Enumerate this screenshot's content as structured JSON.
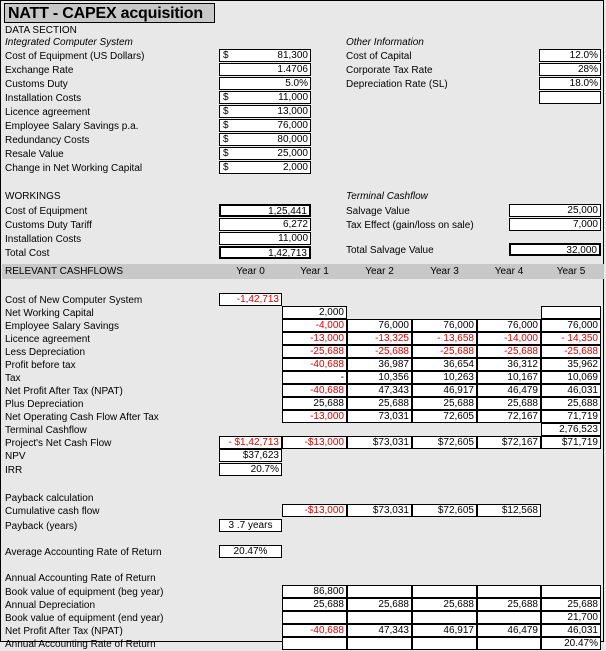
{
  "title": "NATT - CAPEX acquisition",
  "sections": {
    "data_section": "DATA SECTION",
    "workings": "WORKINGS",
    "relevant_cashflows": "RELEVANT CASHFLOWS"
  },
  "data_section": {
    "subtitle": "Integrated Computer System",
    "rows": [
      {
        "label": "Cost of Equipment (US Dollars)",
        "symbol": "$",
        "value": "81,300"
      },
      {
        "label": "Exchange Rate",
        "symbol": "",
        "value": "1.4706"
      },
      {
        "label": "Customs Duty",
        "symbol": "",
        "value": "5.0%"
      },
      {
        "label": "Installation Costs",
        "symbol": "$",
        "value": "11,000"
      },
      {
        "label": "Licence agreement",
        "symbol": "$",
        "value": "13,000"
      },
      {
        "label": "Employee Salary Savings p.a.",
        "symbol": "$",
        "value": "76,000"
      },
      {
        "label": "Redundancy Costs",
        "symbol": "$",
        "value": "80,000"
      },
      {
        "label": "Resale Value",
        "symbol": "$",
        "value": "25,000"
      },
      {
        "label": "Change in Net Working Capital",
        "symbol": "$",
        "value": "2,000"
      }
    ]
  },
  "other_information": {
    "subtitle": "Other Information",
    "rows": [
      {
        "label": "Cost of Capital",
        "value": "12.0%"
      },
      {
        "label": "Corporate Tax Rate",
        "value": "28%"
      },
      {
        "label": "Depreciation Rate (SL)",
        "value": "18.0%"
      }
    ]
  },
  "workings": {
    "rows": [
      {
        "label": "Cost of Equipment",
        "value": "1,25,441"
      },
      {
        "label": "Customs Duty Tariff",
        "value": "6,272"
      },
      {
        "label": "Installation Costs",
        "value": "11,000"
      },
      {
        "label": "Total Cost",
        "value": "1,42,713"
      }
    ]
  },
  "terminal_cashflow": {
    "subtitle": "Terminal Cashflow",
    "rows": [
      {
        "label": "Salvage Value",
        "value": "25,000"
      },
      {
        "label": "Tax Effect (gain/loss on sale)",
        "value": "7,000"
      }
    ],
    "total_label": "Total Salvage Value",
    "total_value": "32,000"
  },
  "cashflow_table": {
    "year_headers": [
      "Year 0",
      "Year 1",
      "Year 2",
      "Year 3",
      "Year 4",
      "Year 5"
    ],
    "rows": [
      {
        "label": "Cost of New Computer System",
        "cells": [
          "-1,42,713",
          "",
          "",
          "",
          "",
          ""
        ],
        "neg": [
          true,
          false,
          false,
          false,
          false,
          false
        ],
        "show": [
          true,
          false,
          false,
          false,
          false,
          false
        ],
        "thick": true
      },
      {
        "label": "Net Working Capital",
        "cells": [
          "",
          "2,000",
          "",
          "",
          "",
          ""
        ],
        "neg": [
          false,
          false,
          false,
          false,
          false,
          false
        ],
        "show": [
          false,
          true,
          false,
          false,
          false,
          true
        ]
      },
      {
        "label": "Employee Salary Savings",
        "cells": [
          "",
          "-4,000",
          "76,000",
          "76,000",
          "76,000",
          "76,000"
        ],
        "neg": [
          false,
          true,
          false,
          false,
          false,
          false
        ],
        "show": [
          false,
          true,
          true,
          true,
          true,
          true
        ]
      },
      {
        "label": "Licence agreement",
        "cells": [
          "",
          "-13,000",
          "-13,325",
          "- 13,658",
          "-14,000",
          "- 14,350"
        ],
        "neg": [
          false,
          true,
          true,
          true,
          true,
          true
        ],
        "show": [
          false,
          true,
          true,
          true,
          true,
          true
        ]
      },
      {
        "label": "Less Depreciation",
        "cells": [
          "",
          "-25,688",
          "-25,688",
          "-25,688",
          "-25,688",
          "-25,688"
        ],
        "neg": [
          false,
          true,
          true,
          true,
          true,
          true
        ],
        "show": [
          false,
          true,
          true,
          true,
          true,
          true
        ]
      },
      {
        "label": "Profit before tax",
        "cells": [
          "",
          "-40,688",
          "36,987",
          "36,654",
          "36,312",
          "35,962"
        ],
        "neg": [
          false,
          true,
          false,
          false,
          false,
          false
        ],
        "show": [
          false,
          true,
          true,
          true,
          true,
          true
        ]
      },
      {
        "label": "Tax",
        "cells": [
          "",
          "-",
          "10,356",
          "10,263",
          "10,167",
          "10,069"
        ],
        "neg": [
          false,
          false,
          false,
          false,
          false,
          false
        ],
        "show": [
          false,
          true,
          true,
          true,
          true,
          true
        ]
      },
      {
        "label": "Net Profit After Tax (NPAT)",
        "cells": [
          "",
          "-40,688",
          "47,343",
          "46,917",
          "46,479",
          "46,031"
        ],
        "neg": [
          false,
          true,
          false,
          false,
          false,
          false
        ],
        "show": [
          false,
          true,
          true,
          true,
          true,
          true
        ]
      },
      {
        "label": "Plus Depreciation",
        "cells": [
          "",
          "25,688",
          "25,688",
          "25,688",
          "25,688",
          "25,688"
        ],
        "neg": [
          false,
          false,
          false,
          false,
          false,
          false
        ],
        "show": [
          false,
          true,
          true,
          true,
          true,
          true
        ]
      },
      {
        "label": "Net Operating Cash Flow After Tax",
        "cells": [
          "",
          "-13,000",
          "73,031",
          "72,605",
          "72,167",
          "71,719"
        ],
        "neg": [
          false,
          true,
          false,
          false,
          false,
          false
        ],
        "show": [
          false,
          true,
          true,
          true,
          true,
          true
        ]
      },
      {
        "label": "Terminal Cashflow",
        "cells": [
          "",
          "",
          "",
          "",
          "",
          "2,76,523"
        ],
        "neg": [
          false,
          false,
          false,
          false,
          false,
          false
        ],
        "show": [
          false,
          false,
          false,
          false,
          false,
          true
        ]
      },
      {
        "label": "Project's Net Cash Flow",
        "cells": [
          "- $1,42,713",
          "-$13,000",
          "$73,031",
          "$72,605",
          "$72,167",
          "$71,719"
        ],
        "neg": [
          true,
          true,
          false,
          false,
          false,
          false
        ],
        "show": [
          true,
          true,
          true,
          true,
          true,
          true
        ],
        "thick": true
      }
    ]
  },
  "npv": {
    "label": "NPV",
    "value": "$37,623"
  },
  "irr": {
    "label": "IRR",
    "value": "20.7%"
  },
  "payback": {
    "heading": "Payback calculation",
    "cumulative_label": "Cumulative cash flow",
    "cumulative_cells": [
      "",
      "-$13,000",
      "$73,031",
      "$72,605",
      "$12,568",
      ""
    ],
    "cumulative_neg": [
      false,
      true,
      false,
      false,
      false,
      false
    ],
    "cumulative_show": [
      false,
      true,
      true,
      true,
      true,
      false
    ],
    "years_label": "Payback (years)",
    "years_value": "3 .7 years"
  },
  "aarr": {
    "label": "Average Accounting Rate of Return",
    "value": "20.47%"
  },
  "annual_arr": {
    "heading": "Annual Accounting Rate of Return",
    "rows": [
      {
        "label": "Book value of equipment (beg year)",
        "cells": [
          "86,800",
          "",
          "",
          "",
          ""
        ],
        "neg": [
          false,
          false,
          false,
          false,
          false
        ],
        "show": [
          true,
          true,
          true,
          true,
          true
        ]
      },
      {
        "label": "Annual Depreciation",
        "cells": [
          "25,688",
          "25,688",
          "25,688",
          "25,688",
          "25,688"
        ],
        "neg": [
          false,
          false,
          false,
          false,
          false
        ],
        "show": [
          true,
          true,
          true,
          true,
          true
        ]
      },
      {
        "label": "Book value of equipment (end year)",
        "cells": [
          "",
          "",
          "",
          "",
          "21,700"
        ],
        "neg": [
          false,
          false,
          false,
          false,
          false
        ],
        "show": [
          true,
          true,
          true,
          true,
          true
        ]
      },
      {
        "label": "Net Profit After Tax (NPAT)",
        "cells": [
          "-40,688",
          "47,343",
          "46,917",
          "46,479",
          "46,031"
        ],
        "neg": [
          true,
          false,
          false,
          false,
          false
        ],
        "show": [
          true,
          true,
          true,
          true,
          true
        ]
      },
      {
        "label": "Annual Accounting Rate of Return",
        "cells": [
          "",
          "",
          "",
          "",
          "20.47%"
        ],
        "neg": [
          false,
          false,
          false,
          false,
          false
        ],
        "show": [
          true,
          true,
          true,
          true,
          true
        ]
      }
    ]
  }
}
